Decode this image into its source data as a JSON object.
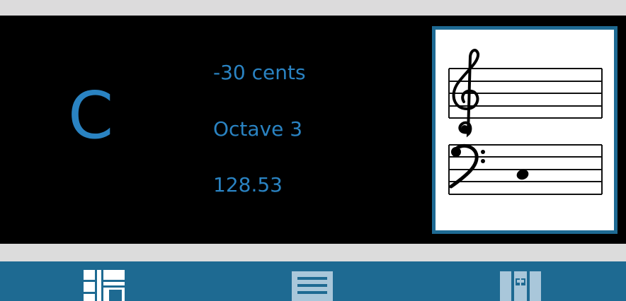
{
  "tuner": {
    "note": "C",
    "cents": "-30 cents",
    "octave": "Octave 3",
    "frequency": "128.53"
  },
  "staff": {
    "clefs": [
      "treble-clef",
      "bass-clef"
    ],
    "note_position": "bass staff, second space from bottom"
  },
  "tabbar": {
    "tabs": [
      {
        "icon": "tuner-grid-icon",
        "selected": true
      },
      {
        "icon": "list-icon",
        "selected": false
      },
      {
        "icon": "piano-keys-icon",
        "selected": false
      }
    ]
  },
  "colors": {
    "accent": "#2a83c2",
    "panel_bg": "#000000",
    "tabbar_bg": "#1e6a92",
    "frame": "#1e6a93",
    "chrome": "#dcdcdc"
  }
}
